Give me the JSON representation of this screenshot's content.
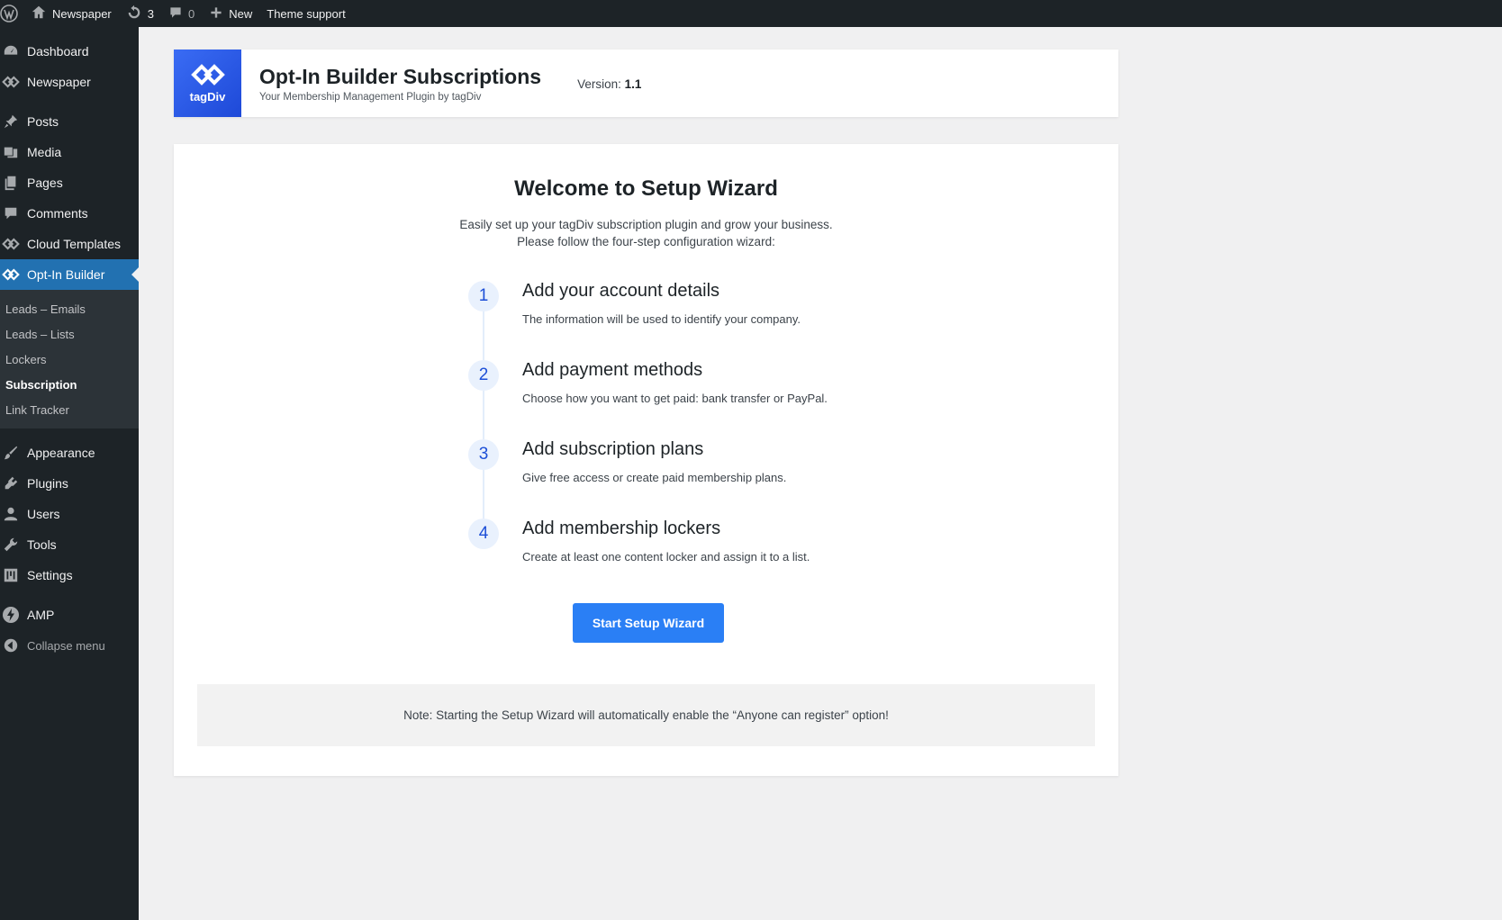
{
  "adminbar": {
    "site_name": "Newspaper",
    "updates_count": "3",
    "comments_count": "0",
    "new_label": "New",
    "theme_support_label": "Theme support"
  },
  "sidebar": {
    "items_top": [
      {
        "label": "Dashboard",
        "icon": "dashboard-icon"
      },
      {
        "label": "Newspaper",
        "icon": "tagdiv-icon"
      }
    ],
    "items_content": [
      {
        "label": "Posts",
        "icon": "pin-icon"
      },
      {
        "label": "Media",
        "icon": "media-icon"
      },
      {
        "label": "Pages",
        "icon": "pages-icon"
      },
      {
        "label": "Comments",
        "icon": "comment-icon"
      },
      {
        "label": "Cloud Templates",
        "icon": "tagdiv-icon"
      },
      {
        "label": "Opt-In Builder",
        "icon": "tagdiv-icon"
      }
    ],
    "submenu": [
      {
        "label": "Leads – Emails"
      },
      {
        "label": "Leads – Lists"
      },
      {
        "label": "Lockers"
      },
      {
        "label": "Subscription"
      },
      {
        "label": "Link Tracker"
      }
    ],
    "items_bottom": [
      {
        "label": "Appearance",
        "icon": "brush-icon"
      },
      {
        "label": "Plugins",
        "icon": "plugin-icon"
      },
      {
        "label": "Users",
        "icon": "user-icon"
      },
      {
        "label": "Tools",
        "icon": "wrench-icon"
      },
      {
        "label": "Settings",
        "icon": "settings-icon"
      }
    ],
    "amp_label": "AMP",
    "collapse_label": "Collapse menu"
  },
  "header": {
    "logo_text": "tagDiv",
    "title": "Opt-In Builder Subscriptions",
    "subtitle": "Your Membership Management Plugin by tagDiv",
    "version_label": "Version:",
    "version_value": "1.1"
  },
  "wizard": {
    "title": "Welcome to Setup Wizard",
    "desc_line1": "Easily set up your tagDiv subscription plugin and grow your business.",
    "desc_line2": "Please follow the four-step configuration wizard:",
    "steps": [
      {
        "num": "1",
        "title": "Add your account details",
        "desc": "The information will be used to identify your company."
      },
      {
        "num": "2",
        "title": "Add payment methods",
        "desc": "Choose how you want to get paid: bank transfer or PayPal."
      },
      {
        "num": "3",
        "title": "Add subscription plans",
        "desc": "Give free access or create paid membership plans."
      },
      {
        "num": "4",
        "title": "Add membership lockers",
        "desc": "Create at least one content locker and assign it to a list."
      }
    ],
    "start_button": "Start Setup Wizard",
    "note": "Note: Starting the Setup Wizard will automatically enable the “Anyone can register” option!"
  },
  "colors": {
    "adminbar_bg": "#1d2327",
    "active_menu": "#2271b1",
    "primary_button": "#2a7ff5",
    "step_number": "#1d4fd7"
  }
}
